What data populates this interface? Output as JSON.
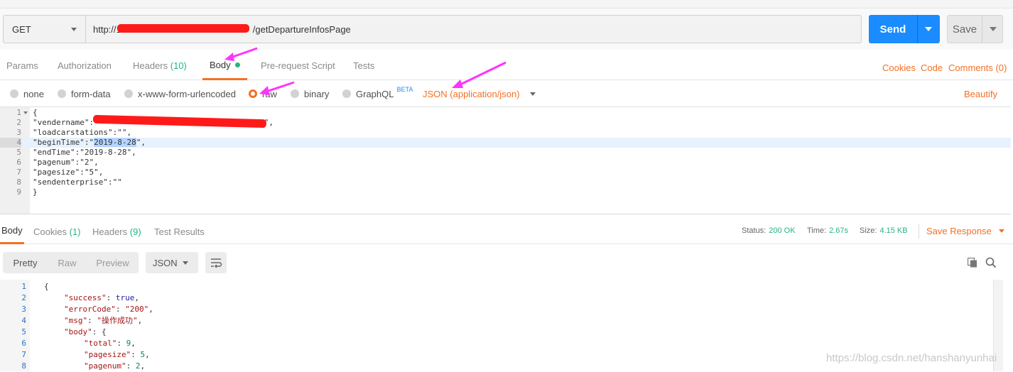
{
  "request": {
    "method": "GET",
    "url_visible_start": "http://1",
    "url_visible_end": "/getDepartureInfosPage",
    "send_label": "Send",
    "save_label": "Save"
  },
  "req_tabs": [
    {
      "label": "Params"
    },
    {
      "label": "Authorization"
    },
    {
      "label": "Headers",
      "count": "(10)"
    },
    {
      "label": "Body"
    },
    {
      "label": "Pre-request Script"
    },
    {
      "label": "Tests"
    }
  ],
  "right_links": {
    "cookies": "Cookies",
    "code": "Code",
    "comments": "Comments (0)"
  },
  "body_options": [
    {
      "label": "none"
    },
    {
      "label": "form-data"
    },
    {
      "label": "x-www-form-urlencoded"
    },
    {
      "label": "raw",
      "selected": true
    },
    {
      "label": "binary"
    },
    {
      "label": "GraphQL",
      "badge": "BETA"
    }
  ],
  "content_type": "JSON (application/json)",
  "beautify": "Beautify",
  "editor_lines": [
    {
      "n": "1",
      "code": "{"
    },
    {
      "n": "2",
      "code": "\"vendername\":\"",
      "code_end": "\","
    },
    {
      "n": "3",
      "code": "\"loadcarstations\":\"\","
    },
    {
      "n": "4",
      "pre": "\"beginTime\":\"",
      "sel": "2019-8-28",
      "post": "\","
    },
    {
      "n": "5",
      "code": "\"endTime\":\"2019-8-28\","
    },
    {
      "n": "6",
      "code": "\"pagenum\":\"2\","
    },
    {
      "n": "7",
      "code": "\"pagesize\":\"5\","
    },
    {
      "n": "8",
      "code": "\"sendenterprise\":\"\""
    },
    {
      "n": "9",
      "code": "}"
    }
  ],
  "resp_tabs": [
    {
      "label": "Body"
    },
    {
      "label": "Cookies",
      "count": "(1)"
    },
    {
      "label": "Headers",
      "count": "(9)"
    },
    {
      "label": "Test Results"
    }
  ],
  "status": {
    "status_label": "Status:",
    "status_value": "200 OK",
    "time_label": "Time:",
    "time_value": "2.67s",
    "size_label": "Size:",
    "size_value": "4.15 KB",
    "save_response": "Save Response"
  },
  "view_modes": [
    "Pretty",
    "Raw",
    "Preview"
  ],
  "format": "JSON",
  "response_lines": [
    {
      "n": "1",
      "indent": 0,
      "text": "{"
    },
    {
      "n": "2",
      "indent": 1,
      "key": "\"success\"",
      "val": "true",
      "vtype": "kw"
    },
    {
      "n": "3",
      "indent": 1,
      "key": "\"errorCode\"",
      "val": "\"200\"",
      "vtype": "sv"
    },
    {
      "n": "4",
      "indent": 1,
      "key": "\"msg\"",
      "val": "\"操作成功\"",
      "vtype": "sv"
    },
    {
      "n": "5",
      "indent": 1,
      "key": "\"body\"",
      "val": "{",
      "vtype": "plain",
      "nocomma": true
    },
    {
      "n": "6",
      "indent": 2,
      "key": "\"total\"",
      "val": "9",
      "vtype": "nv"
    },
    {
      "n": "7",
      "indent": 2,
      "key": "\"pagesize\"",
      "val": "5",
      "vtype": "nv"
    },
    {
      "n": "8",
      "indent": 2,
      "key": "\"pagenum\"",
      "val": "2",
      "vtype": "nv"
    }
  ],
  "watermark": "https://blog.csdn.net/hanshanyunhai",
  "colors": {
    "accent": "#f47023",
    "send": "#1a8cff",
    "green": "#26b47f",
    "annotation": "#ff33ff",
    "redaction": "#ff1a1a"
  }
}
